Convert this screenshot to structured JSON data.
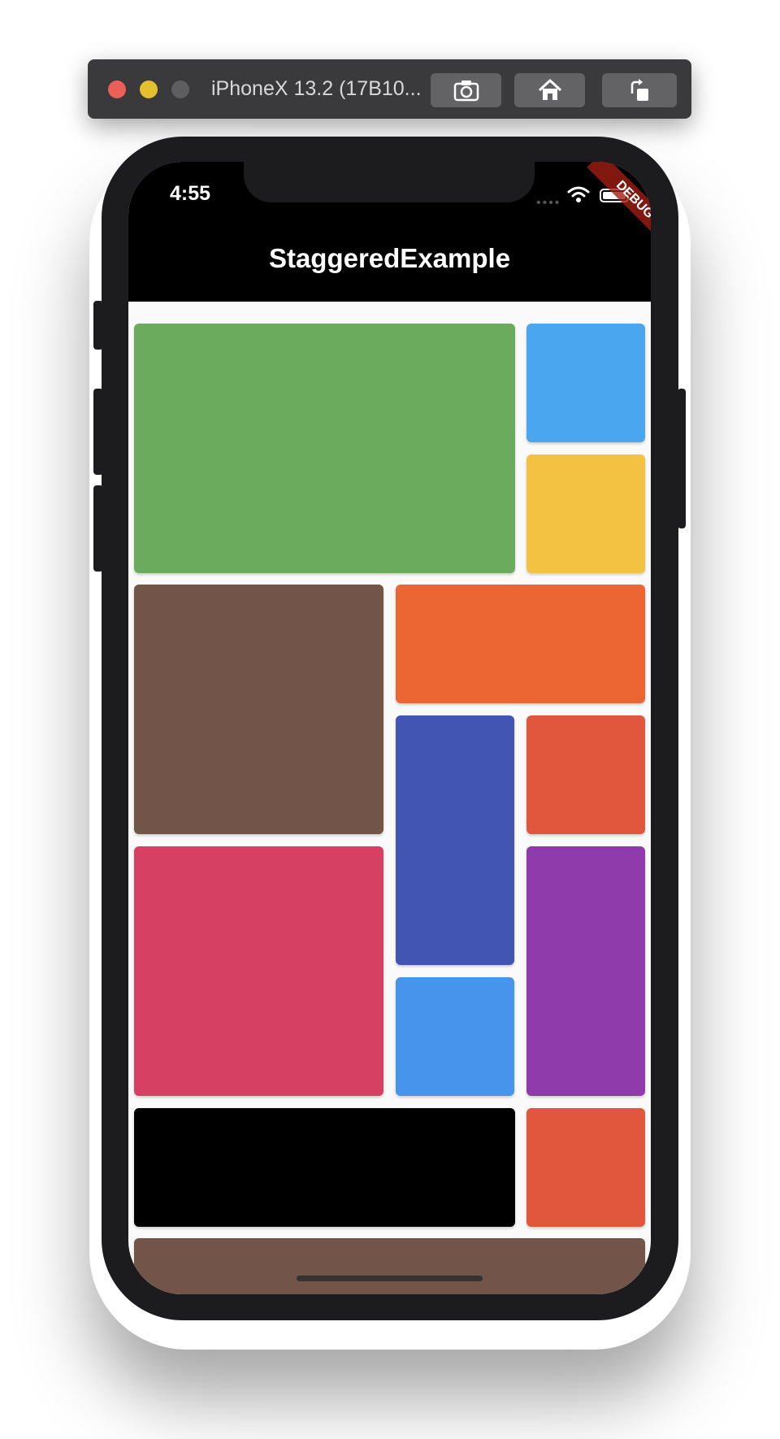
{
  "simulator": {
    "title": "iPhoneX 13.2 (17B10...",
    "buttons": [
      "screenshot-icon",
      "home-icon",
      "rotate-icon"
    ]
  },
  "status_bar": {
    "time": "4:55",
    "icons": [
      "signal-icon",
      "wifi-icon",
      "battery-icon"
    ]
  },
  "app_bar": {
    "title": "StaggeredExample",
    "debug_banner": "DEBUG"
  },
  "colors": {
    "green": "#6aab5e",
    "light_blue": "#4aa6ef",
    "amber": "#f4c242",
    "brown": "#725548",
    "deep_orange": "#ec6634",
    "indigo": "#4255b2",
    "red_orange": "#e1573e",
    "pink": "#d64063",
    "blue": "#4694ec",
    "purple": "#8f3bab",
    "black": "#000000",
    "appbar": "#000000"
  },
  "grid_tiles": [
    {
      "name": "tile-green",
      "color": "#6aab5e"
    },
    {
      "name": "tile-light-blue",
      "color": "#4aa6ef"
    },
    {
      "name": "tile-amber",
      "color": "#f4c242"
    },
    {
      "name": "tile-brown",
      "color": "#725548"
    },
    {
      "name": "tile-deep-orange",
      "color": "#ec6634"
    },
    {
      "name": "tile-indigo",
      "color": "#4255b2"
    },
    {
      "name": "tile-red-orange",
      "color": "#e1573e"
    },
    {
      "name": "tile-pink",
      "color": "#d64063"
    },
    {
      "name": "tile-purple",
      "color": "#8f3bab"
    },
    {
      "name": "tile-blue",
      "color": "#4694ec"
    },
    {
      "name": "tile-black",
      "color": "#000000"
    },
    {
      "name": "tile-red-orange-2",
      "color": "#e1573e"
    },
    {
      "name": "tile-brown-2",
      "color": "#725548"
    }
  ]
}
